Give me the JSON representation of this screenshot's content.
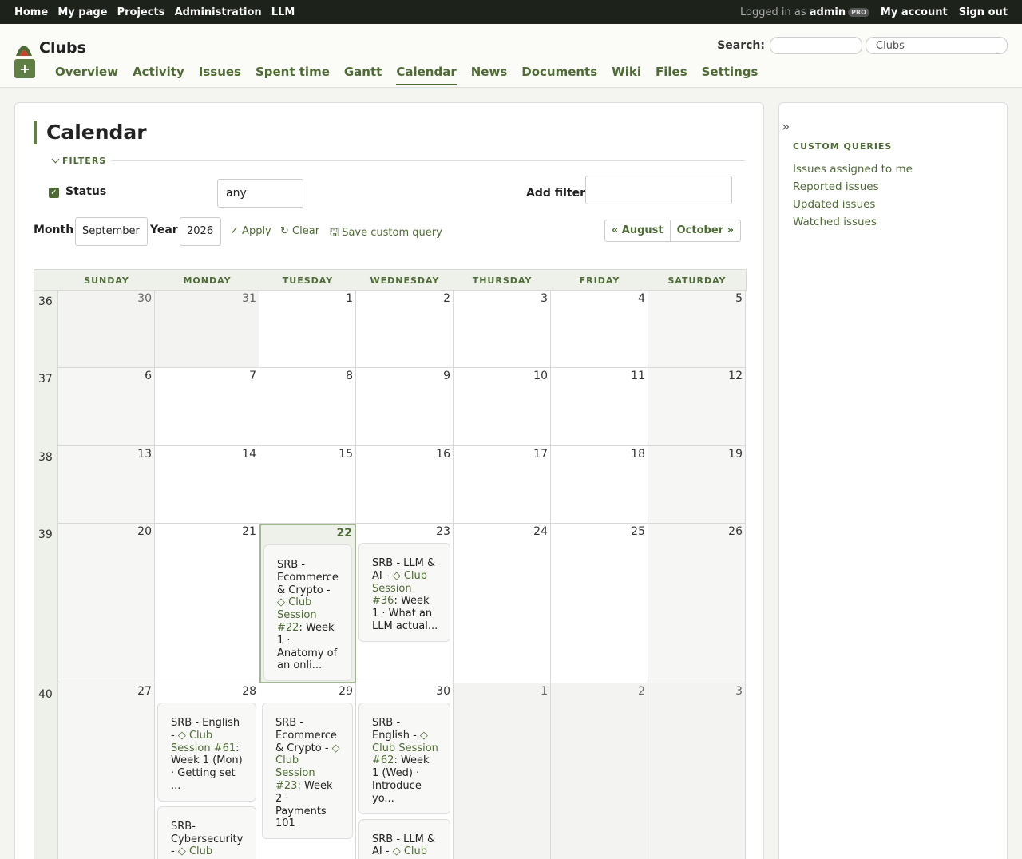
{
  "top_menu": {
    "left": [
      "Home",
      "My page",
      "Projects",
      "Administration",
      "LLM"
    ],
    "logged_in_prefix": "Logged in as",
    "user": "admin",
    "badge": "PRO",
    "my_account": "My account",
    "sign_out": "Sign out"
  },
  "header": {
    "project": "Clubs",
    "new_label": "+",
    "search_label": "Search:",
    "jump_value": "Clubs",
    "tabs": [
      "Overview",
      "Activity",
      "Issues",
      "Spent time",
      "Gantt",
      "Calendar",
      "News",
      "Documents",
      "Wiki",
      "Files",
      "Settings"
    ],
    "selected_tab": "Calendar"
  },
  "page": {
    "title": "Calendar",
    "filters_legend": "FILTERS",
    "status_label": "Status",
    "status_value": "any",
    "add_filter_label": "Add filter",
    "month_label": "Month",
    "month_value": "September",
    "year_label": "Year",
    "year_value": "2026",
    "apply": "Apply",
    "clear": "Clear",
    "save": "Save custom query",
    "prev": "« August",
    "next": "October »"
  },
  "calendar": {
    "weekdays": [
      "SUNDAY",
      "MONDAY",
      "TUESDAY",
      "WEDNESDAY",
      "THURSDAY",
      "FRIDAY",
      "SATURDAY"
    ],
    "weeks": [
      {
        "num": "36",
        "days": [
          "30",
          "31",
          "1",
          "2",
          "3",
          "4",
          "5"
        ]
      },
      {
        "num": "37",
        "days": [
          "6",
          "7",
          "8",
          "9",
          "10",
          "11",
          "12"
        ]
      },
      {
        "num": "38",
        "days": [
          "13",
          "14",
          "15",
          "16",
          "17",
          "18",
          "19"
        ]
      },
      {
        "num": "39",
        "days": [
          "20",
          "21",
          "22",
          "23",
          "24",
          "25",
          "26"
        ]
      },
      {
        "num": "40",
        "days": [
          "27",
          "28",
          "29",
          "30",
          "1",
          "2",
          "3"
        ]
      }
    ],
    "issues": {
      "w39_tue": {
        "pre": "SRB - Ecommerce & Crypto - ",
        "link": "◇ Club Session #22",
        "post": ": Week 1 · Anatomy of an onli..."
      },
      "w39_wed": {
        "pre": "SRB - LLM & AI - ",
        "link": "◇ Club Session #36",
        "post": ": Week 1 · What an LLM actual..."
      },
      "w40_mon_1": {
        "pre": "SRB - English - ",
        "link": "◇ Club Session #61",
        "post": ": Week 1 (Mon) · Getting set ..."
      },
      "w40_mon_2": {
        "pre": "SRB- Cybersecurity - ",
        "link": "◇ Club Session",
        "post": ""
      },
      "w40_tue": {
        "pre": "SRB - Ecommerce & Crypto - ",
        "link": "◇ Club Session #23",
        "post": ": Week 2 · Payments 101"
      },
      "w40_wed_1": {
        "pre": "SRB - English - ",
        "link": "◇ Club Session #62",
        "post": ": Week 1 (Wed) · Introduce yo..."
      },
      "w40_wed_2": {
        "pre": "SRB - LLM & AI - ",
        "link": "◇ Club Session",
        "post": ""
      }
    }
  },
  "sidebar": {
    "toggle": "»",
    "heading": "CUSTOM QUERIES",
    "items": [
      "Issues assigned to me",
      "Reported issues",
      "Updated issues",
      "Watched issues"
    ]
  }
}
